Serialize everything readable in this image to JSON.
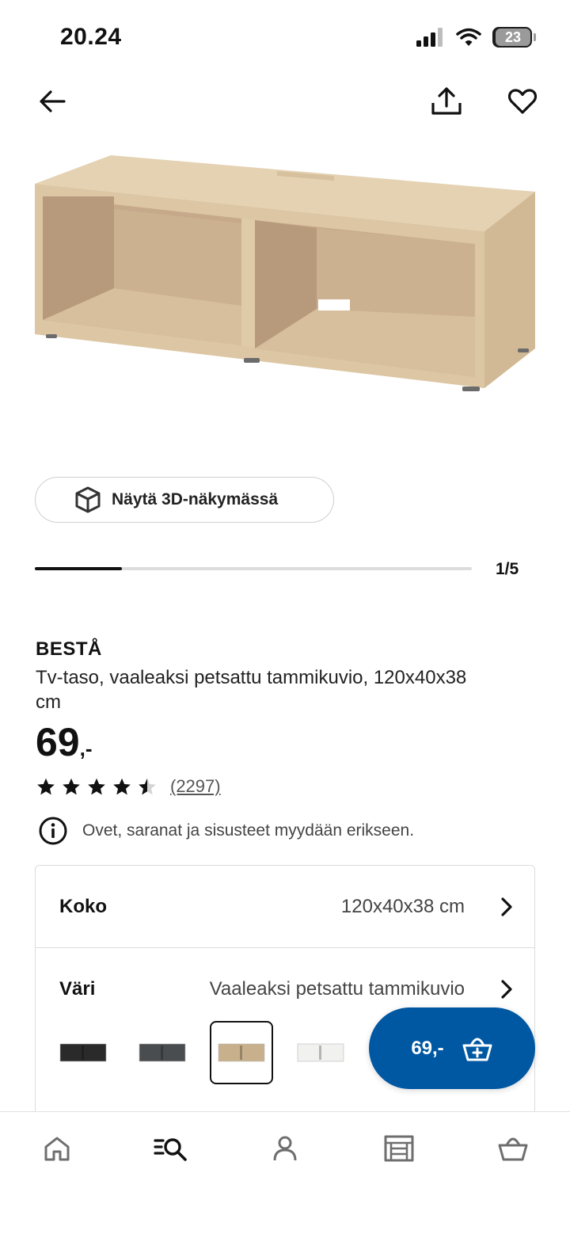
{
  "status_bar": {
    "time": "20.24",
    "battery": "23",
    "icons": [
      "signal-icon",
      "wifi-icon",
      "battery-icon"
    ]
  },
  "top_nav": {
    "icons": [
      "back-arrow-icon",
      "share-icon",
      "heart-icon"
    ]
  },
  "gallery": {
    "view3d_label": "Näytä 3D-näkymässä",
    "page_indicator": "1/5",
    "current_image": 1,
    "image_count": 5
  },
  "product": {
    "name": "BESTÅ",
    "description": "Tv-taso, vaaleaksi petsattu tammikuvio, 120x40x38 cm",
    "price": "69",
    "price_suffix": ",-",
    "rating": 4.5,
    "review_count": "(2297)",
    "notice": "Ovet, saranat ja sisusteet myydään erikseen."
  },
  "options": {
    "size_label": "Koko",
    "size_value": "120x40x38 cm",
    "color_label": "Väri",
    "color_value": "Vaaleaksi petsattu tammikuvio",
    "swatches": [
      {
        "name": "black",
        "color": "#2a2a2a"
      },
      {
        "name": "dark-grey",
        "color": "#4a4d4f"
      },
      {
        "name": "white-stained-oak",
        "color": "#c9b08c",
        "selected": true
      },
      {
        "name": "white",
        "color": "#f1f1ef"
      }
    ]
  },
  "cart": {
    "price": "69,-"
  },
  "bottom_nav": {
    "items": [
      "home-icon",
      "search-browse-icon",
      "profile-icon",
      "store-icon",
      "basket-icon"
    ],
    "active": "search-browse-icon"
  },
  "colors": {
    "brand_blue": "#0058a3",
    "wood": "#d9c3a1"
  }
}
